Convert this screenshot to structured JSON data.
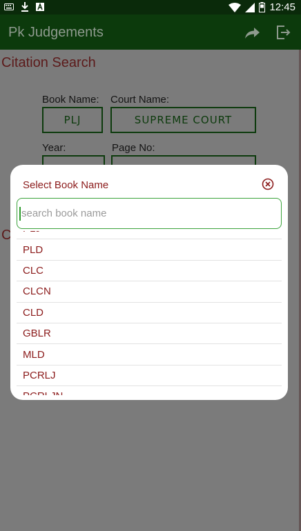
{
  "status_bar": {
    "time": "12:45",
    "left_icons": [
      "keyboard-icon",
      "download-icon",
      "a-box-icon"
    ],
    "right_icons": [
      "wifi-icon",
      "signal-icon",
      "battery-icon"
    ]
  },
  "app_bar": {
    "title": "Pk Judgements",
    "actions": [
      "share-icon",
      "exit-icon"
    ]
  },
  "page": {
    "section_title": "Citation Search",
    "section_title_2_partial": "C",
    "book_name_label": "Book Name:",
    "court_name_label": "Court Name:",
    "book_name_value": "PLJ",
    "court_name_value": "SUPREME COURT",
    "year_label": "Year:",
    "page_no_label": "Page No:"
  },
  "dialog": {
    "title": "Select Book Name",
    "search_placeholder": "search book name",
    "items": [
      "PLJ",
      "PLD",
      "CLC",
      "CLCN",
      "CLD",
      "GBLR",
      "MLD",
      "PCRLJ",
      "PCRLJN"
    ]
  },
  "colors": {
    "app_bar": "#0c3a0c",
    "status_bar": "#0a2a0a",
    "accent_text": "#8b1a1a",
    "search_border": "#3aa23a"
  }
}
